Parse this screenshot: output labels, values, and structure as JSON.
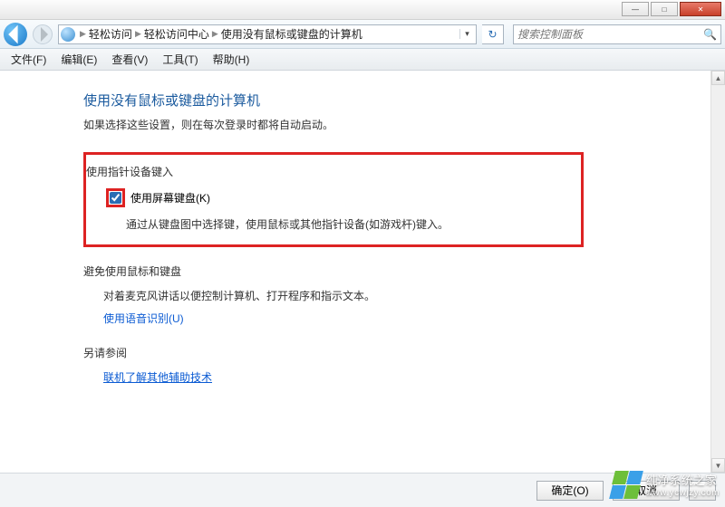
{
  "titlebar": {
    "min": "—",
    "max": "□",
    "close": "✕"
  },
  "nav": {
    "crumbs": [
      "轻松访问",
      "轻松访问中心",
      "使用没有鼠标或键盘的计算机"
    ],
    "search_placeholder": "搜索控制面板"
  },
  "menu": {
    "file": "文件(F)",
    "edit": "编辑(E)",
    "view": "查看(V)",
    "tools": "工具(T)",
    "help": "帮助(H)"
  },
  "main": {
    "heading": "使用没有鼠标或键盘的计算机",
    "desc": "如果选择这些设置，则在每次登录时都将自动启动。",
    "section1_title": "使用指针设备键入",
    "checkbox_label": "使用屏幕键盘(K)",
    "checkbox_checked": true,
    "hint": "通过从键盘图中选择键，使用鼠标或其他指针设备(如游戏杆)键入。",
    "section2_title": "避免使用鼠标和键盘",
    "section2_desc": "对着麦克风讲话以便控制计算机、打开程序和指示文本。",
    "section2_link": "使用语音识别(U)",
    "section3_title": "另请参阅",
    "section3_link": "联机了解其他辅助技术"
  },
  "footer": {
    "ok": "确定(O)",
    "cancel": "取消"
  },
  "watermark": {
    "line1": "纯净系统之家",
    "line2": "www.ycwjzy.com"
  }
}
